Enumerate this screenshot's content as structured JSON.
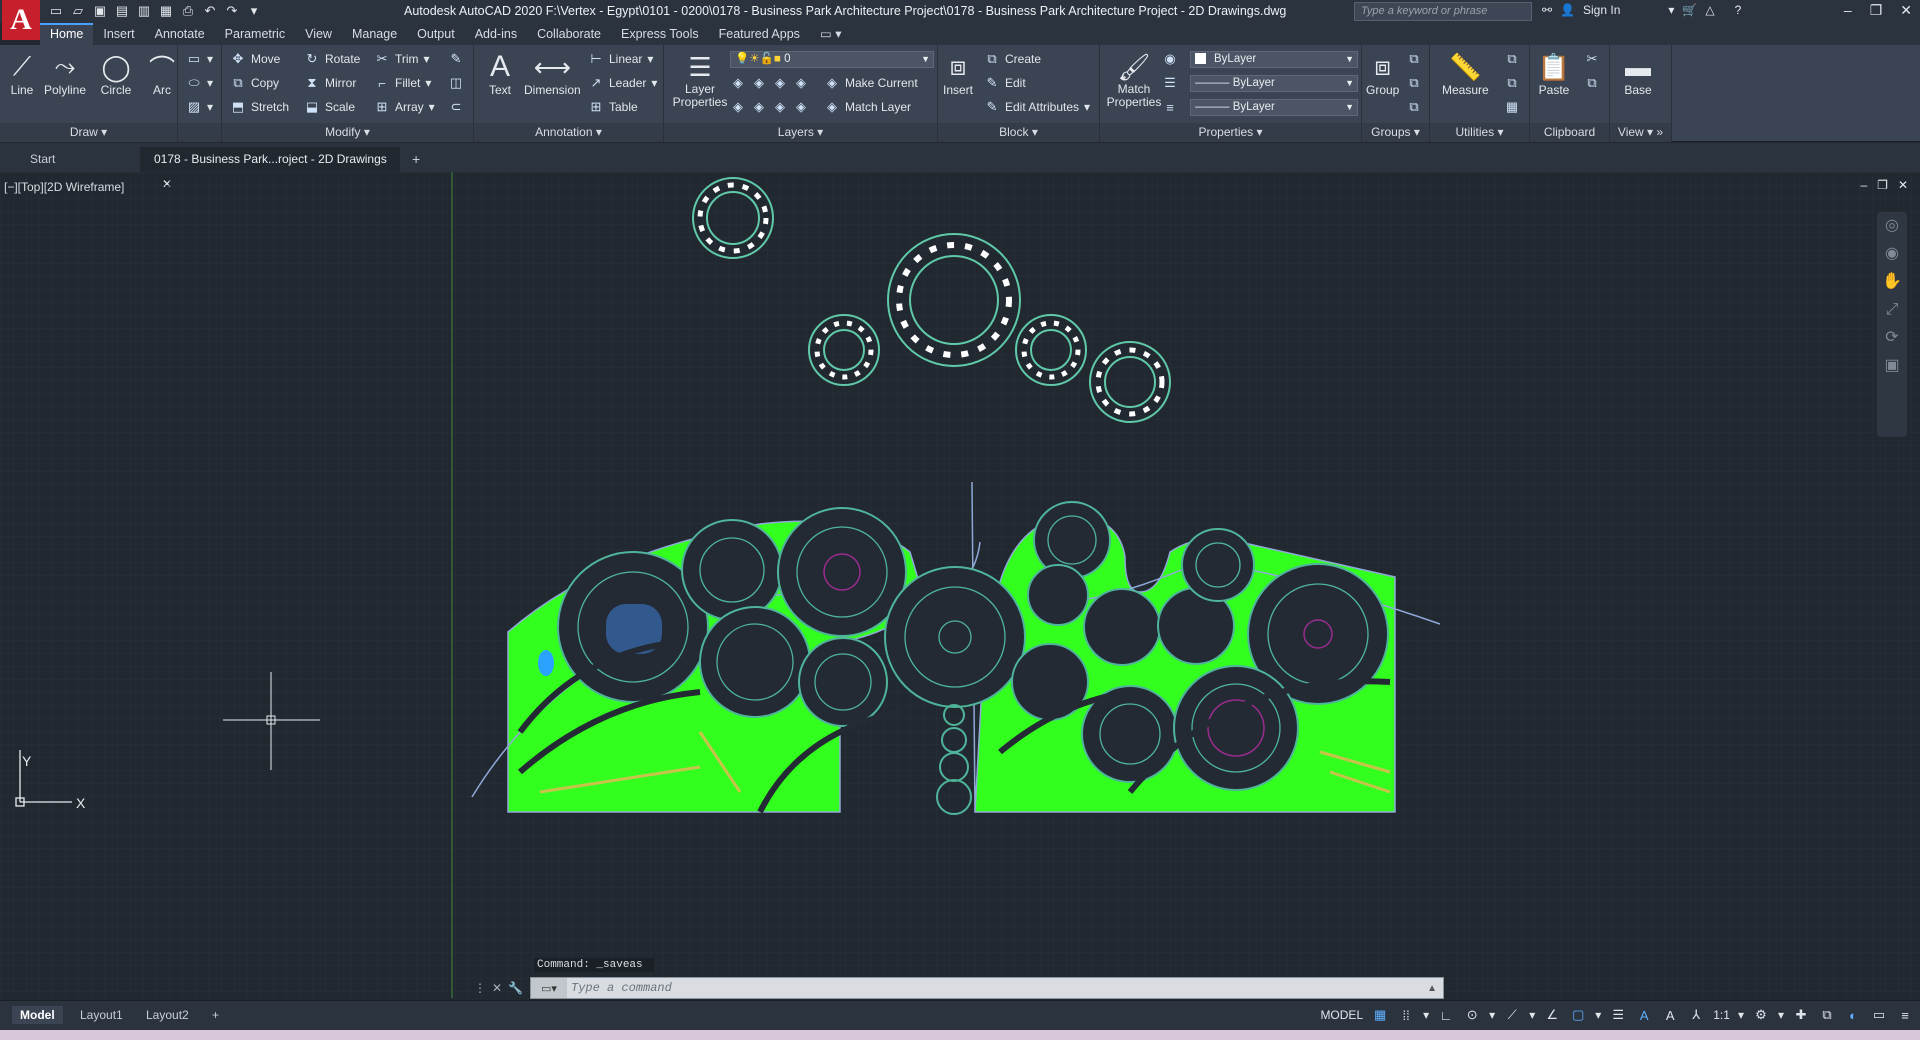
{
  "app": {
    "logo": "A",
    "title": "Autodesk AutoCAD 2020    F:\\Vertex - Egypt\\0101 - 0200\\0178 - Business Park Architecture Project\\0178 - Business Park Architecture Project - 2D Drawings.dwg",
    "search_placeholder": "Type a keyword or phrase",
    "sign_in": "Sign In"
  },
  "menu_tabs": [
    "Home",
    "Insert",
    "Annotate",
    "Parametric",
    "View",
    "Manage",
    "Output",
    "Add-ins",
    "Collaborate",
    "Express Tools",
    "Featured Apps"
  ],
  "ribbon": {
    "draw": {
      "title": "Draw",
      "line": "Line",
      "polyline": "Polyline",
      "circle": "Circle",
      "arc": "Arc"
    },
    "modify": {
      "title": "Modify",
      "move": "Move",
      "rotate": "Rotate",
      "trim": "Trim",
      "copy": "Copy",
      "mirror": "Mirror",
      "fillet": "Fillet",
      "stretch": "Stretch",
      "scale": "Scale",
      "array": "Array"
    },
    "annotation": {
      "title": "Annotation",
      "text": "Text",
      "dimension": "Dimension",
      "linear": "Linear",
      "leader": "Leader",
      "table": "Table"
    },
    "layers": {
      "title": "Layers",
      "layer_properties": "Layer Properties",
      "current_layer": "0",
      "make_current": "Make Current",
      "match_layer": "Match Layer"
    },
    "block": {
      "title": "Block",
      "insert": "Insert",
      "create": "Create",
      "edit": "Edit",
      "edit_attributes": "Edit Attributes"
    },
    "properties": {
      "title": "Properties",
      "match_properties": "Match Properties",
      "color": "ByLayer",
      "linetype": "ByLayer",
      "lineweight": "ByLayer"
    },
    "groups": {
      "title": "Groups",
      "group": "Group"
    },
    "utilities": {
      "title": "Utilities",
      "measure": "Measure"
    },
    "clipboard": {
      "title": "Clipboard",
      "paste": "Paste"
    },
    "view": {
      "title": "View",
      "base": "Base"
    }
  },
  "doc_tabs": {
    "start": "Start",
    "active": "0178 - Business Park...roject - 2D Drawings"
  },
  "viewport_label": "[−][Top][2D Wireframe]",
  "ucs": {
    "y": "Y",
    "x": "X"
  },
  "command": {
    "history": "Command: _saveas",
    "placeholder": "Type a command"
  },
  "layout_tabs": [
    "Model",
    "Layout1",
    "Layout2"
  ],
  "status": {
    "model": "MODEL",
    "scale": "1:1"
  },
  "colors": {
    "plan_fill": "#33ff1f",
    "plan_line": "#2e7d62",
    "outline": "#8fa8d8",
    "canvas": "#212830"
  }
}
